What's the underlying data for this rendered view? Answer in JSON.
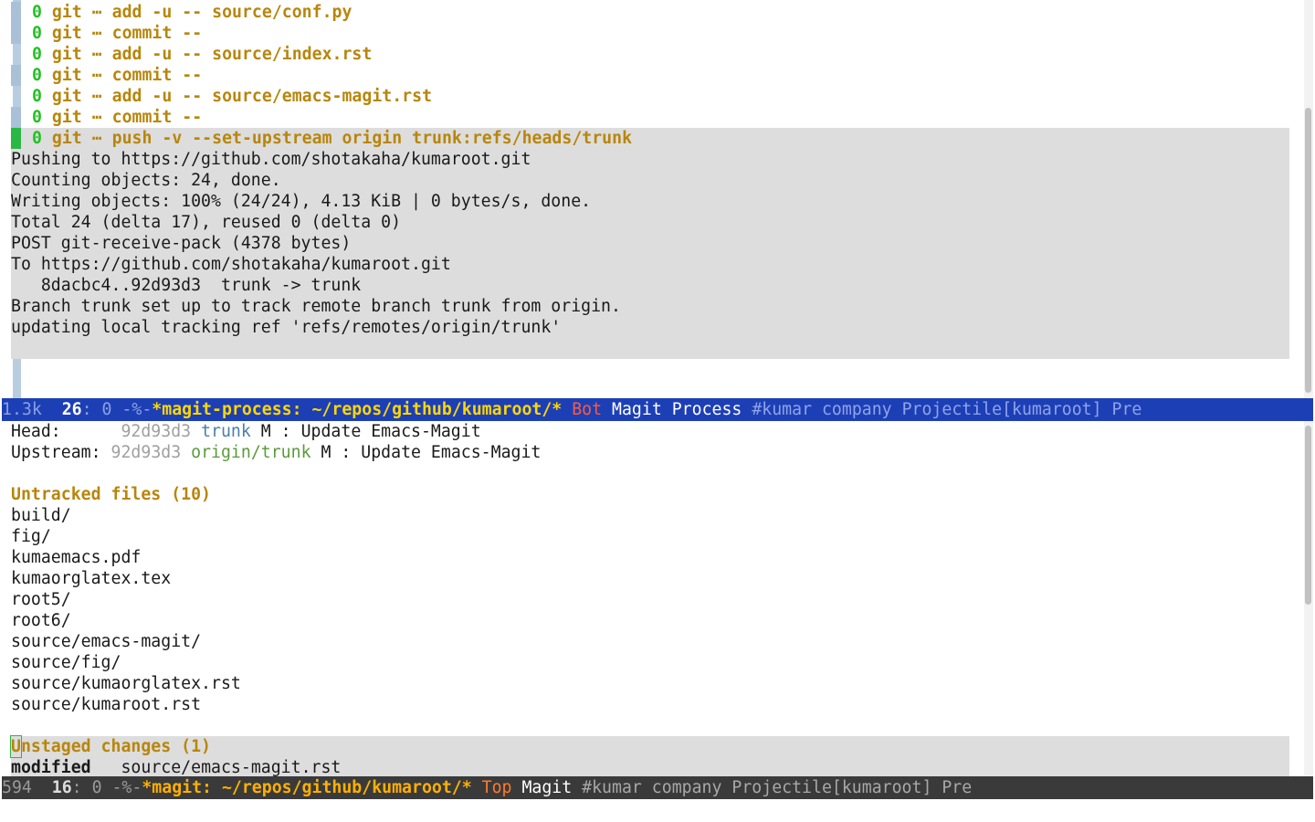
{
  "process_buffer": {
    "commands": [
      {
        "exit": "0",
        "git": "git",
        "ellipsis": "⋯",
        "args": "add -u -- source/conf.py"
      },
      {
        "exit": "0",
        "git": "git",
        "ellipsis": "⋯",
        "args": "commit --"
      },
      {
        "exit": "0",
        "git": "git",
        "ellipsis": "⋯",
        "args": "add -u -- source/index.rst"
      },
      {
        "exit": "0",
        "git": "git",
        "ellipsis": "⋯",
        "args": "commit --"
      },
      {
        "exit": "0",
        "git": "git",
        "ellipsis": "⋯",
        "args": "add -u -- source/emacs-magit.rst"
      },
      {
        "exit": "0",
        "git": "git",
        "ellipsis": "⋯",
        "args": "commit --"
      },
      {
        "exit": "0",
        "git": "git",
        "ellipsis": "⋯",
        "args": "push -v --set-upstream origin trunk:refs/heads/trunk"
      }
    ],
    "output": [
      "Pushing to https://github.com/shotakaha/kumaroot.git",
      "Counting objects: 24, done.",
      "Writing objects: 100% (24/24), 4.13 KiB | 0 bytes/s, done.",
      "Total 24 (delta 17), reused 0 (delta 0)",
      "POST git-receive-pack (4378 bytes)",
      "To https://github.com/shotakaha/kumaroot.git",
      "   8dacbc4..92d93d3  trunk -> trunk",
      "Branch trunk set up to track remote branch trunk from origin.",
      "updating local tracking ref 'refs/remotes/origin/trunk'"
    ]
  },
  "modeline_process": {
    "size": "1.3k",
    "line": "26",
    "col": ": 0",
    "flags": " -%-",
    "buffer": "*magit-process: ~/repos/github/kumaroot/*",
    "position": "Bot",
    "major_mode": "Magit Process",
    "minor_modes": "#kumar company Projectile[kumaroot] Pre"
  },
  "status_buffer": {
    "head_label": "Head:",
    "head_hash": "92d93d3",
    "head_branch": "trunk",
    "head_msg": "M : Update Emacs-Magit",
    "upstream_label": "Upstream:",
    "upstream_hash": "92d93d3",
    "upstream_branch": "origin/trunk",
    "upstream_msg": "M : Update Emacs-Magit",
    "untracked_heading": "Untracked files (10)",
    "untracked": [
      "build/",
      "fig/",
      "kumaemacs.pdf",
      "kumaorglatex.tex",
      "root5/",
      "root6/",
      "source/emacs-magit/",
      "source/fig/",
      "source/kumaorglatex.rst",
      "source/kumaroot.rst"
    ],
    "unstaged_heading_first": "U",
    "unstaged_heading_rest": "nstaged changes (1)",
    "unstaged_status": "modified",
    "unstaged_file": "source/emacs-magit.rst"
  },
  "modeline_status": {
    "size": "594",
    "line": "16",
    "col": ": 0",
    "flags": " -%-",
    "buffer": "*magit: ~/repos/github/kumaroot/*",
    "position": "Top",
    "major_mode": "Magit",
    "minor_modes": "#kumar company Projectile[kumaroot] Pre"
  },
  "colors": {
    "modeline_active": "#1d3fb6",
    "modeline_inactive": "#3a3a3a",
    "section_heading": "#b8860b",
    "exit_ok": "#22c222"
  }
}
